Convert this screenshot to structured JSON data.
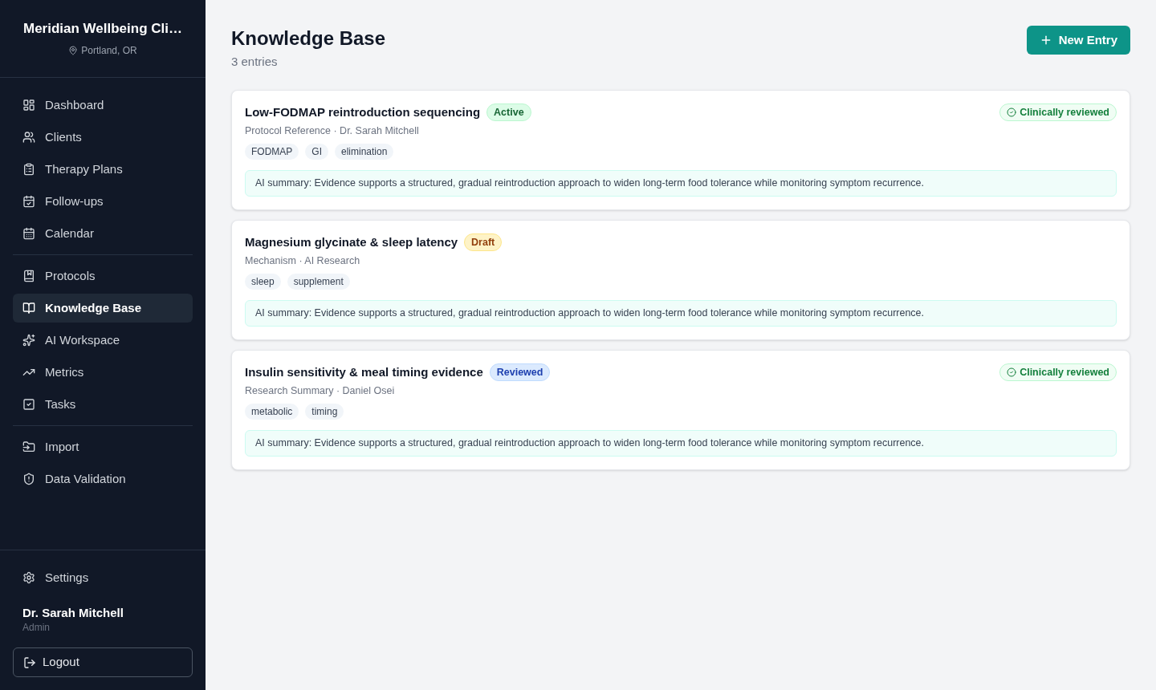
{
  "sidebar": {
    "clinic_name": "Meridian Wellbeing Cli…",
    "location": "Portland, OR",
    "nav_groups": [
      {
        "items": [
          {
            "label": "Dashboard",
            "selected": false
          },
          {
            "label": "Clients",
            "selected": false
          },
          {
            "label": "Therapy Plans",
            "selected": false
          },
          {
            "label": "Follow-ups",
            "selected": false
          },
          {
            "label": "Calendar",
            "selected": false
          }
        ]
      },
      {
        "items": [
          {
            "label": "Protocols",
            "selected": false
          },
          {
            "label": "Knowledge Base",
            "selected": true
          },
          {
            "label": "AI Workspace",
            "selected": false
          },
          {
            "label": "Metrics",
            "selected": false
          },
          {
            "label": "Tasks",
            "selected": false
          }
        ]
      },
      {
        "items": [
          {
            "label": "Import",
            "selected": false
          },
          {
            "label": "Data Validation",
            "selected": false
          }
        ]
      }
    ],
    "settings": "Settings",
    "user": {
      "name": "Dr. Sarah Mitchell",
      "role": "Admin"
    },
    "logout": "Logout"
  },
  "page": {
    "title": "Knowledge Base",
    "count": "3 entries",
    "new_button": "New Entry"
  },
  "entries": [
    {
      "title": "Low-FODMAP reintroduction sequencing",
      "status": {
        "label": "Active",
        "kind": "active"
      },
      "review_label": "Clinically reviewed",
      "meta": "Protocol Reference · Dr. Sarah Mitchell",
      "tags": [
        "FODMAP",
        "GI",
        "elimination"
      ],
      "summary": "AI summary: Evidence supports a structured, gradual reintroduction approach to widen long-term food tolerance while monitoring symptom recurrence."
    },
    {
      "title": "Magnesium glycinate & sleep latency",
      "status": {
        "label": "Draft",
        "kind": "draft"
      },
      "meta": "Mechanism · AI Research",
      "tags": [
        "sleep",
        "supplement"
      ],
      "summary": "AI summary: Evidence supports a structured, gradual reintroduction approach to widen long-term food tolerance while monitoring symptom recurrence."
    },
    {
      "title": "Insulin sensitivity & meal timing evidence",
      "status": {
        "label": "Reviewed",
        "kind": "reviewed"
      },
      "review_label": "Clinically reviewed",
      "meta": "Research Summary · Daniel Osei",
      "tags": [
        "metabolic",
        "timing"
      ],
      "summary": "AI summary: Evidence supports a structured, gradual reintroduction approach to widen long-term food tolerance while monitoring symptom recurrence."
    }
  ]
}
